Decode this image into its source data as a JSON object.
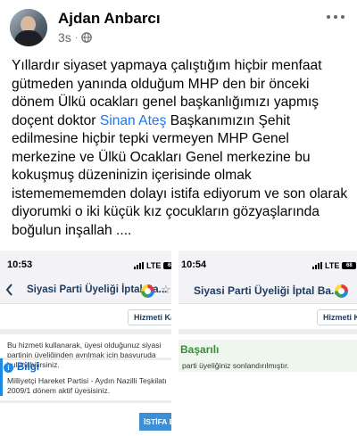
{
  "post": {
    "author": "Ajdan Anbarcı",
    "time": "3s",
    "dot": "·",
    "text_part1": "Yıllardır siyaset yapmaya çalıştığım hiçbir menfaat gütmeden yanında olduğum MHP den bir önceki dönem Ülkü ocakları genel başkanlığımızı yapmış doçent doktor ",
    "mention": "Sinan Ateş",
    "text_part2": " Başkanımızın Şehit edilmesine hiçbir tepki vermeyen MHP Genel merkezine ve Ülkü Ocakları Genel merkezine bu kokuşmuş düzeninizin içerisinde olmak istememememden dolayı istifa ediyorum ve son olarak diyorumki o iki küçük kız çocukların gözyaşlarında boğulun inşallah ...."
  },
  "screenshot_left": {
    "time": "10:53",
    "carrier": "LTE",
    "battery": "68",
    "title": "Siyasi Parti Üyeliği İptal Ba...",
    "close_button": "Hizmeti Kapat",
    "info_text": "Bu hizmeti kullanarak, üyesi olduğunuz siyasi partinin üyeliğinden ayrılmak için başvuruda bulunabilirsiniz.",
    "bilgi_label": "Bilgi",
    "bilgi_text": "Milliyetçi Hareket Partisi - Aydın Nazilli Teşkilatı 2009/1 dönem aktif üyesisiniz.",
    "istifa_button": "İSTİFA ET"
  },
  "screenshot_right": {
    "time": "10:54",
    "carrier": "LTE",
    "battery": "68",
    "title": "Siyasi Parti Üyeliği İptal Ba...",
    "close_button": "Hizmeti Kapat",
    "success_title": "Başarılı",
    "success_text": "parti üyeliğiniz sonlandırılmıştır."
  },
  "colors": {
    "mention": "#1877f2",
    "nav_title": "#1e3b5c",
    "success": "#3a8a3a",
    "info": "#1e88e5"
  }
}
